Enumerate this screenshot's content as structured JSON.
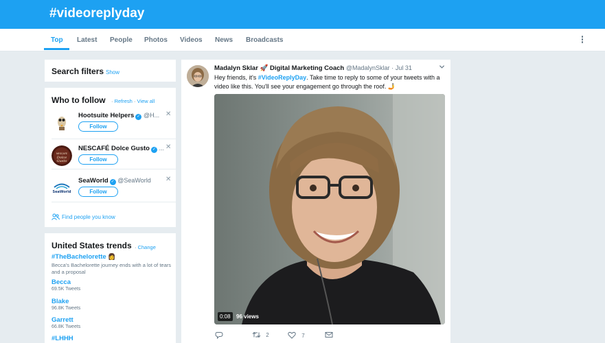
{
  "header": {
    "title": "#videoreplyday"
  },
  "tabs": [
    "Top",
    "Latest",
    "People",
    "Photos",
    "Videos",
    "News",
    "Broadcasts"
  ],
  "active_tab": "Top",
  "search_filters": {
    "title": "Search filters",
    "show": "Show"
  },
  "who_to_follow": {
    "title": "Who to follow",
    "refresh": "Refresh",
    "view_all": "View all",
    "follow_label": "Follow",
    "accounts": [
      {
        "name": "Hootsuite Helpers",
        "handle": "@H..."
      },
      {
        "name": "NESCAFÉ Dolce Gusto",
        "handle": "..."
      },
      {
        "name": "SeaWorld",
        "handle": "@SeaWorld"
      }
    ],
    "find_people": "Find people you know"
  },
  "trends": {
    "title": "United States trends",
    "change": "Change",
    "items": [
      {
        "name": "#TheBachelorette",
        "desc": "Becca's Bachelorette journey ends with a lot of tears and a proposal"
      },
      {
        "name": "Becca",
        "count": "69.5K Tweets"
      },
      {
        "name": "Blake",
        "count": "96.8K Tweets"
      },
      {
        "name": "Garrett",
        "count": "66.8K Tweets"
      },
      {
        "name": "#LHHH"
      }
    ]
  },
  "tweet": {
    "name": "Madalyn Sklar 🚀 Digital Marketing Coach",
    "handle": "@MadalynSklar",
    "date": "Jul 31",
    "text_before": "Hey friends, it's ",
    "hashtag": "#VideoReplyDay",
    "text_after": ". Take time to reply to some of your tweets with a video like this. You'll see your engagement go through the roof. 🤳",
    "video_time": "0:08",
    "video_views": "96 views",
    "retweets": "2",
    "likes": "7"
  },
  "colors": {
    "brand": "#1da1f2",
    "background": "#e6ecf0"
  }
}
